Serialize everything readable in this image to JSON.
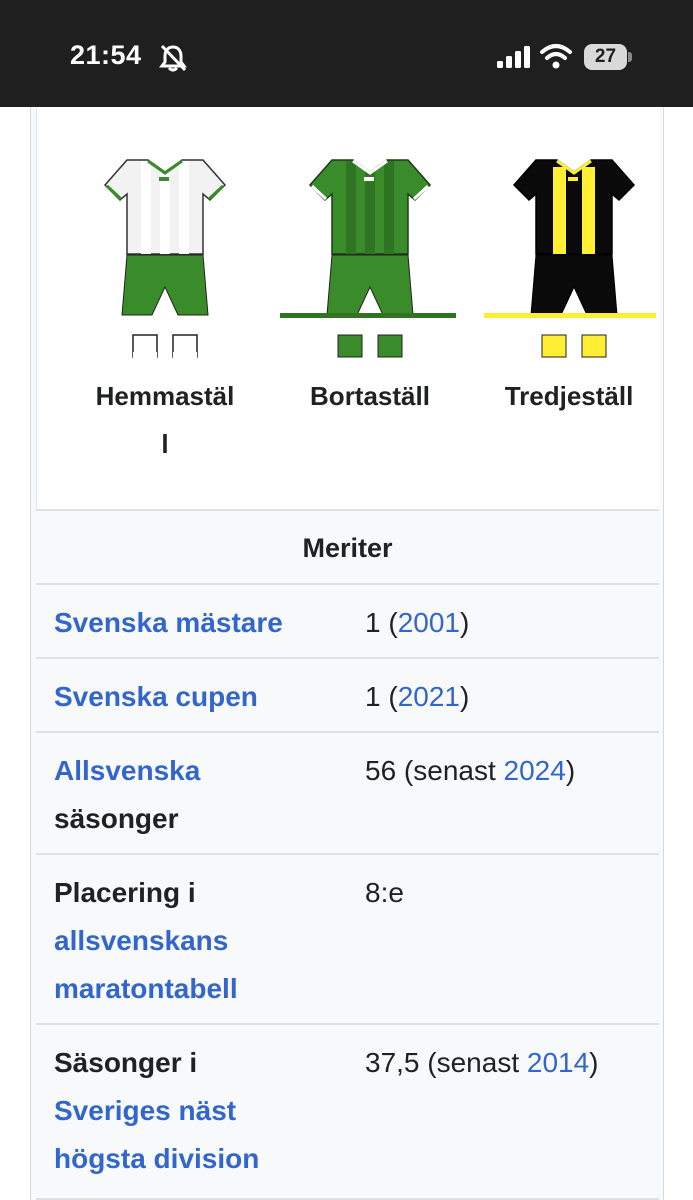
{
  "status_bar": {
    "time": "21:54",
    "battery": "27",
    "icons": [
      "bell-slash-icon",
      "cellular-signal-icon",
      "wifi-icon",
      "battery-icon"
    ]
  },
  "kits": [
    {
      "label_line1": "Hemmastäl",
      "label_line2": "l",
      "shirt_color": "#f2f2f2",
      "shorts_color": "#3a8c2a",
      "socks_color": "#ffffff"
    },
    {
      "label_line1": "Bortaställ",
      "label_line2": "",
      "shirt_color": "#3a8c2a",
      "shorts_color": "#3a8c2a",
      "socks_color": "#3a8c2a"
    },
    {
      "label_line1": "Tredjeställ",
      "label_line2": "",
      "shirt_color": "#0a0a0a",
      "shorts_color": "#0a0a0a",
      "socks_color": "#ffee33"
    }
  ],
  "meriter": {
    "header": "Meriter",
    "rows": [
      {
        "label": [
          "Svenska mästare"
        ],
        "label_link": [
          true
        ],
        "value_pre": "1 (",
        "value_link": "2001",
        "value_post": ")"
      },
      {
        "label": [
          "Svenska cupen"
        ],
        "label_link": [
          true
        ],
        "value_pre": "1 (",
        "value_link": "2021",
        "value_post": ")"
      },
      {
        "label": [
          "Allsvenska",
          "säsonger"
        ],
        "label_link": [
          true,
          false
        ],
        "value_pre": "56 (senast ",
        "value_link": "2024",
        "value_post": ")"
      },
      {
        "label": [
          "Placering i",
          "allsvenskans",
          "maratontabell"
        ],
        "label_link": [
          false,
          true,
          true
        ],
        "value_pre": "8:e",
        "value_link": "",
        "value_post": ""
      },
      {
        "label": [
          "Säsonger i",
          "Sveriges näst",
          "högsta division"
        ],
        "label_link": [
          false,
          true,
          true
        ],
        "value_pre": "37,5 (senast ",
        "value_link": "2014",
        "value_post": ")"
      }
    ]
  },
  "colors": {
    "link": "#3366cc",
    "text": "#202122",
    "infobox_bg": "#f8f9fa"
  }
}
